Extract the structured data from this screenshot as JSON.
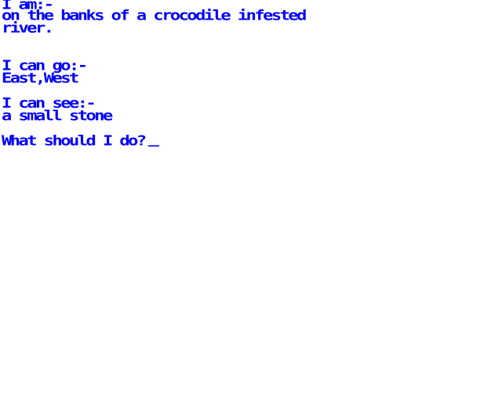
{
  "location": {
    "header": "I am:-",
    "description_line1": "on the banks of a crocodile infested",
    "description_line2": "river."
  },
  "exits": {
    "header": "I can go:-",
    "list": "East,West"
  },
  "items": {
    "header": "I can see:-",
    "list": "a small stone"
  },
  "prompt": {
    "text": "What should I do?",
    "input_value": ""
  },
  "colors": {
    "text": "#0000ff",
    "background": "#ffffff"
  }
}
